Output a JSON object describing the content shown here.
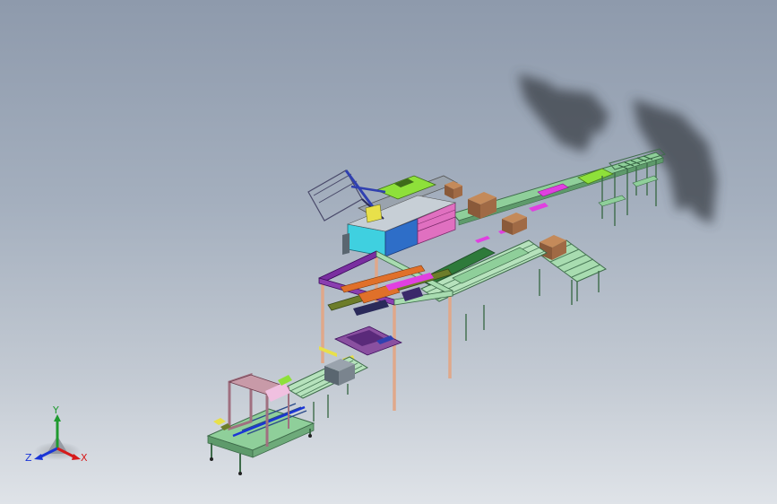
{
  "view": {
    "background_top": "#8e9aac",
    "background_bottom": "#dfe3e8",
    "shadow_color": "#3a3f47"
  },
  "triad": {
    "y_label": "Y",
    "z_label": "Z",
    "x_label": "X",
    "y_color": "#1f9a2f",
    "z_color": "#1a35d6",
    "x_color": "#d61a1a"
  },
  "colors": {
    "frame_green": "#8fcf9a",
    "frame_dark": "#3e6b4a",
    "magenta": "#e040e0",
    "cyan": "#3fd0e0",
    "blue_cab": "#2e6ec8",
    "pink_cab": "#e070c0",
    "lime": "#8ee03a",
    "olive": "#6d7d2a",
    "box_brown": "#a06a45",
    "tan_post": "#e0a88a",
    "purple": "#7a2ea0",
    "orange": "#e0702a",
    "yellow": "#e8e04a"
  }
}
